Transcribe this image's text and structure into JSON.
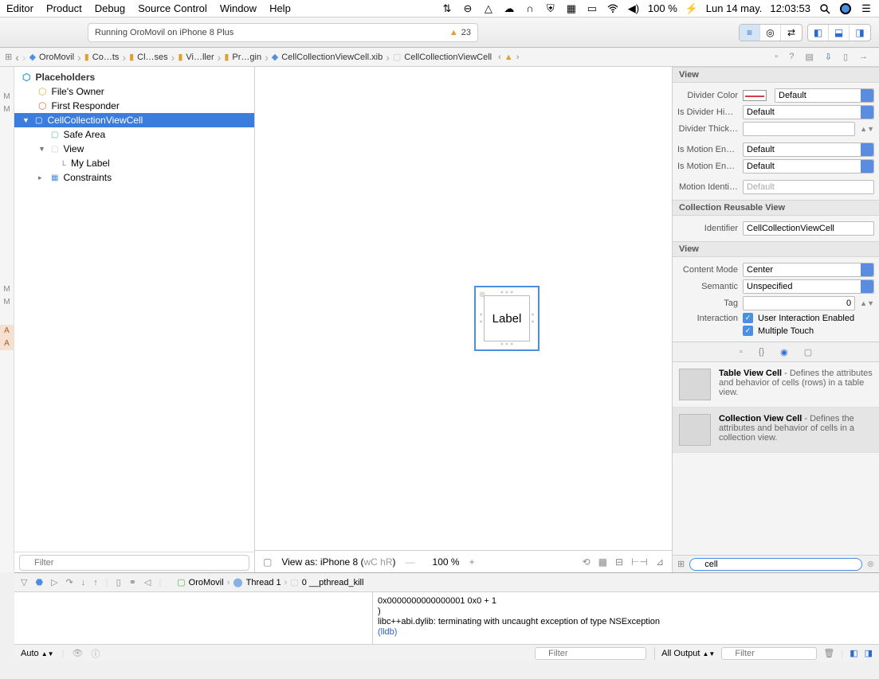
{
  "menubar": {
    "items": [
      "Editor",
      "Product",
      "Debug",
      "Source Control",
      "Window",
      "Help"
    ],
    "battery": "100 %",
    "date": "Lun 14 may.",
    "time": "12:03:53"
  },
  "toolbar": {
    "status": "Running OroMovil on iPhone 8 Plus",
    "warnings": "23"
  },
  "breadcrumbs": [
    "OroMovil",
    "Co…ts",
    "Cl…ses",
    "Vi…ller",
    "Pr…gin",
    "CellCollectionViewCell.xib",
    "CellCollectionViewCell"
  ],
  "gutter": [
    "M",
    "M",
    "",
    "",
    "",
    "",
    "",
    "",
    "",
    "",
    "",
    "",
    "",
    "",
    "",
    "",
    "M",
    "M",
    "",
    "A",
    "A"
  ],
  "navigator": {
    "placeholders_label": "Placeholders",
    "files_owner": "File's Owner",
    "first_responder": "First Responder",
    "cell": "CellCollectionViewCell",
    "safe_area": "Safe Area",
    "view": "View",
    "my_label": "My Label",
    "constraints": "Constraints",
    "filter_placeholder": "Filter"
  },
  "canvas": {
    "label_text": "Label",
    "view_as": "View as: iPhone 8 (",
    "traits": "wC hR",
    "traits_close": ")",
    "zoom": "100 %"
  },
  "inspector": {
    "section_view": "View",
    "divider_color": "Divider Color",
    "divider_color_val": "Default",
    "is_divider_hidden": "Is Divider Hid…",
    "is_divider_hidden_val": "Default",
    "divider_thickness": "Divider Thick…",
    "is_motion_enabled": "Is Motion Ena…",
    "is_motion_enabled_val": "Default",
    "is_motion_enabled2": "Is Motion Ena…",
    "is_motion_enabled2_val": "Default",
    "motion_identifier": "Motion Identi…",
    "motion_identifier_placeholder": "Default",
    "section_reusable": "Collection Reusable View",
    "identifier": "Identifier",
    "identifier_val": "CellCollectionViewCell",
    "section_view2": "View",
    "content_mode": "Content Mode",
    "content_mode_val": "Center",
    "semantic": "Semantic",
    "semantic_val": "Unspecified",
    "tag": "Tag",
    "tag_val": "0",
    "interaction": "Interaction",
    "interaction_chk1": "User Interaction Enabled",
    "interaction_chk2": "Multiple Touch"
  },
  "library": {
    "items": [
      {
        "title": "Table View Cell",
        "desc": " - Defines the attributes and behavior of cells (rows) in a table view."
      },
      {
        "title": "Collection View Cell",
        "desc": " - Defines the attributes and behavior of cells in a collection view."
      }
    ],
    "filter": "cell"
  },
  "debug": {
    "target": "OroMovil",
    "thread": "Thread 1",
    "frame": "0 __pthread_kill",
    "console_line1": "0x0000000000000001 0x0 + 1",
    "console_line2": ")",
    "console_line3": "libc++abi.dylib: terminating with uncaught exception of type NSException",
    "console_lldb": "(lldb)",
    "auto": "Auto",
    "left_filter_placeholder": "Filter",
    "output": "All Output",
    "right_filter_placeholder": "Filter"
  }
}
